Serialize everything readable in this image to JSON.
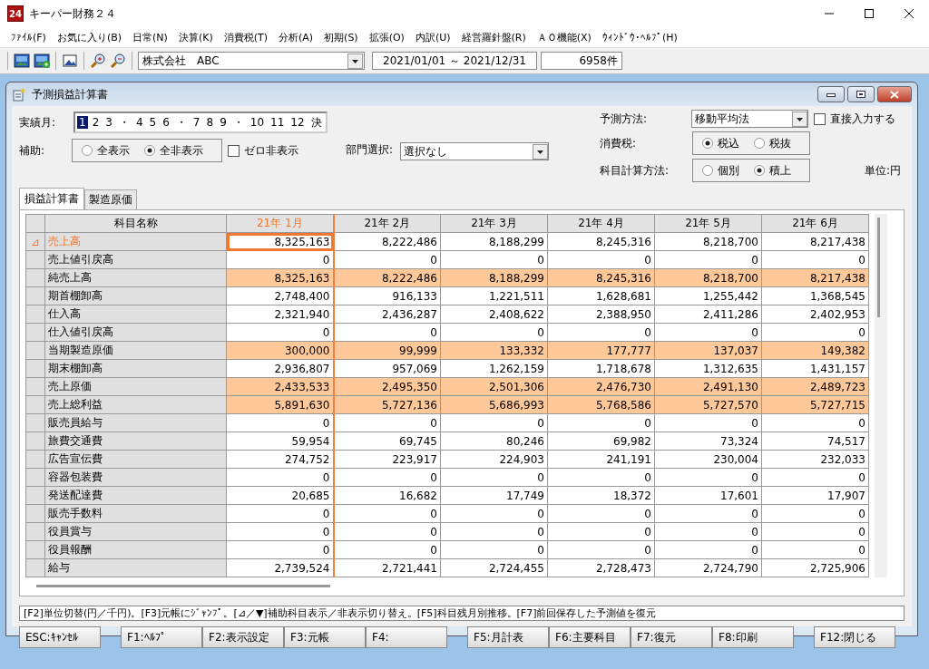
{
  "app": {
    "title": "キーパー財務２４",
    "logo": "24"
  },
  "menu": [
    "ﾌｧｲﾙ(F)",
    "お気に入り(B)",
    "日常(N)",
    "決算(K)",
    "消費税(T)",
    "分析(A)",
    "初期(S)",
    "拡張(O)",
    "内訳(U)",
    "経営羅針盤(R)",
    "ＡＯ機能(X)",
    "ｳｨﾝﾄﾞｳ･ﾍﾙﾌﾟ(H)"
  ],
  "toolbar": {
    "company": "株式会社　ABC",
    "period": "2021/01/01 ～ 2021/12/31",
    "count": "6958件"
  },
  "child": {
    "title": "予測損益計算書"
  },
  "months": {
    "label": "実績月:",
    "items": [
      {
        "kind": "month",
        "label": "1",
        "selected": true
      },
      {
        "kind": "month",
        "label": "2",
        "selected": false
      },
      {
        "kind": "month",
        "label": "3",
        "selected": false
      },
      {
        "kind": "sep",
        "label": "・"
      },
      {
        "kind": "month",
        "label": "4",
        "selected": false
      },
      {
        "kind": "month",
        "label": "5",
        "selected": false
      },
      {
        "kind": "month",
        "label": "6",
        "selected": false
      },
      {
        "kind": "sep",
        "label": "・"
      },
      {
        "kind": "month",
        "label": "7",
        "selected": false
      },
      {
        "kind": "month",
        "label": "8",
        "selected": false
      },
      {
        "kind": "month",
        "label": "9",
        "selected": false
      },
      {
        "kind": "sep",
        "label": "・"
      },
      {
        "kind": "month",
        "label": "10",
        "selected": false
      },
      {
        "kind": "month",
        "label": "11",
        "selected": false
      },
      {
        "kind": "month",
        "label": "12",
        "selected": false
      },
      {
        "kind": "month",
        "label": "決",
        "selected": false
      }
    ]
  },
  "aux": {
    "label": "補助:",
    "options": [
      {
        "label": "全表示",
        "selected": false
      },
      {
        "label": "全非表示",
        "selected": true
      }
    ],
    "zero_hide": {
      "label": "ゼロ非表示",
      "checked": false
    }
  },
  "dept": {
    "label": "部門選択:",
    "value": "選択なし"
  },
  "forecast": {
    "label": "予測方法:",
    "value": "移動平均法",
    "direct": {
      "label": "直接入力する",
      "checked": false
    }
  },
  "tax": {
    "label": "消費税:",
    "options": [
      {
        "label": "税込",
        "selected": true
      },
      {
        "label": "税抜",
        "selected": false
      }
    ]
  },
  "calc": {
    "label": "科目計算方法:",
    "options": [
      {
        "label": "個別",
        "selected": false
      },
      {
        "label": "積上",
        "selected": true
      }
    ]
  },
  "unit": "単位:円",
  "tabs": [
    {
      "label": "損益計算書",
      "selected": true
    },
    {
      "label": "製造原価",
      "selected": false
    }
  ],
  "table": {
    "name_column": "科目名称",
    "columns": [
      {
        "label": "21年 1月",
        "selected": true
      },
      {
        "label": "21年 2月",
        "selected": false
      },
      {
        "label": "21年 3月",
        "selected": false
      },
      {
        "label": "21年 4月",
        "selected": false
      },
      {
        "label": "21年 5月",
        "selected": false
      },
      {
        "label": "21年 6月",
        "selected": false
      }
    ],
    "rows": [
      {
        "marker": "⊿",
        "name": "売上高",
        "selected": true,
        "highlighted": false,
        "values": [
          "8,325,163",
          "8,222,486",
          "8,188,299",
          "8,245,316",
          "8,218,700",
          "8,217,438"
        ]
      },
      {
        "name": "売上値引戻高",
        "selected": false,
        "highlighted": false,
        "values": [
          "0",
          "0",
          "0",
          "0",
          "0",
          "0"
        ]
      },
      {
        "name": "純売上高",
        "selected": false,
        "highlighted": true,
        "values": [
          "8,325,163",
          "8,222,486",
          "8,188,299",
          "8,245,316",
          "8,218,700",
          "8,217,438"
        ]
      },
      {
        "name": "期首棚卸高",
        "selected": false,
        "highlighted": false,
        "values": [
          "2,748,400",
          "916,133",
          "1,221,511",
          "1,628,681",
          "1,255,442",
          "1,368,545"
        ]
      },
      {
        "name": "仕入高",
        "selected": false,
        "highlighted": false,
        "values": [
          "2,321,940",
          "2,436,287",
          "2,408,622",
          "2,388,950",
          "2,411,286",
          "2,402,953"
        ]
      },
      {
        "name": "仕入値引戻高",
        "selected": false,
        "highlighted": false,
        "values": [
          "0",
          "0",
          "0",
          "0",
          "0",
          "0"
        ]
      },
      {
        "name": "当期製造原価",
        "selected": false,
        "highlighted": true,
        "values": [
          "300,000",
          "99,999",
          "133,332",
          "177,777",
          "137,037",
          "149,382"
        ]
      },
      {
        "name": "期末棚卸高",
        "selected": false,
        "highlighted": false,
        "values": [
          "2,936,807",
          "957,069",
          "1,262,159",
          "1,718,678",
          "1,312,635",
          "1,431,157"
        ]
      },
      {
        "name": "売上原価",
        "selected": false,
        "highlighted": true,
        "values": [
          "2,433,533",
          "2,495,350",
          "2,501,306",
          "2,476,730",
          "2,491,130",
          "2,489,723"
        ]
      },
      {
        "name": "売上総利益",
        "selected": false,
        "highlighted": true,
        "values": [
          "5,891,630",
          "5,727,136",
          "5,686,993",
          "5,768,586",
          "5,727,570",
          "5,727,715"
        ]
      },
      {
        "name": "販売員給与",
        "selected": false,
        "highlighted": false,
        "values": [
          "0",
          "0",
          "0",
          "0",
          "0",
          "0"
        ]
      },
      {
        "name": "旅費交通費",
        "selected": false,
        "highlighted": false,
        "values": [
          "59,954",
          "69,745",
          "80,246",
          "69,982",
          "73,324",
          "74,517"
        ]
      },
      {
        "name": "広告宣伝費",
        "selected": false,
        "highlighted": false,
        "values": [
          "274,752",
          "223,917",
          "224,903",
          "241,191",
          "230,004",
          "232,033"
        ]
      },
      {
        "name": "容器包装費",
        "selected": false,
        "highlighted": false,
        "values": [
          "0",
          "0",
          "0",
          "0",
          "0",
          "0"
        ]
      },
      {
        "name": "発送配達費",
        "selected": false,
        "highlighted": false,
        "values": [
          "20,685",
          "16,682",
          "17,749",
          "18,372",
          "17,601",
          "17,907"
        ]
      },
      {
        "name": "販売手数料",
        "selected": false,
        "highlighted": false,
        "values": [
          "0",
          "0",
          "0",
          "0",
          "0",
          "0"
        ]
      },
      {
        "name": "役員賞与",
        "selected": false,
        "highlighted": false,
        "values": [
          "0",
          "0",
          "0",
          "0",
          "0",
          "0"
        ]
      },
      {
        "name": "役員報酬",
        "selected": false,
        "highlighted": false,
        "values": [
          "0",
          "0",
          "0",
          "0",
          "0",
          "0"
        ]
      },
      {
        "name": "給与",
        "selected": false,
        "highlighted": false,
        "values": [
          "2,739,524",
          "2,721,441",
          "2,724,455",
          "2,728,473",
          "2,724,790",
          "2,725,906"
        ]
      }
    ]
  },
  "hint": "[F2]単位切替(円／千円)。[F3]元帳にｼﾞｬﾝﾌﾟ。[⊿／▼]補助科目表示／非表示切り替え。[F5]科目残月別推移。[F7]前回保存した予測値を復元",
  "buttons": [
    {
      "label": "ESC:ｷｬﾝｾﾙ",
      "kind": "key"
    },
    {
      "kind": "gap"
    },
    {
      "label": "F1:ﾍﾙﾌﾟ",
      "kind": "key"
    },
    {
      "label": "F2:表示設定",
      "kind": "key"
    },
    {
      "label": "F3:元帳",
      "kind": "key"
    },
    {
      "label": "F4:",
      "kind": "key"
    },
    {
      "kind": "gap"
    },
    {
      "label": "F5:月計表",
      "kind": "key"
    },
    {
      "label": "F6:主要科目",
      "kind": "key"
    },
    {
      "label": "F7:復元",
      "kind": "key"
    },
    {
      "label": "F8:印刷",
      "kind": "key"
    },
    {
      "kind": "gap"
    },
    {
      "label": "F12:閉じる",
      "kind": "key"
    }
  ]
}
